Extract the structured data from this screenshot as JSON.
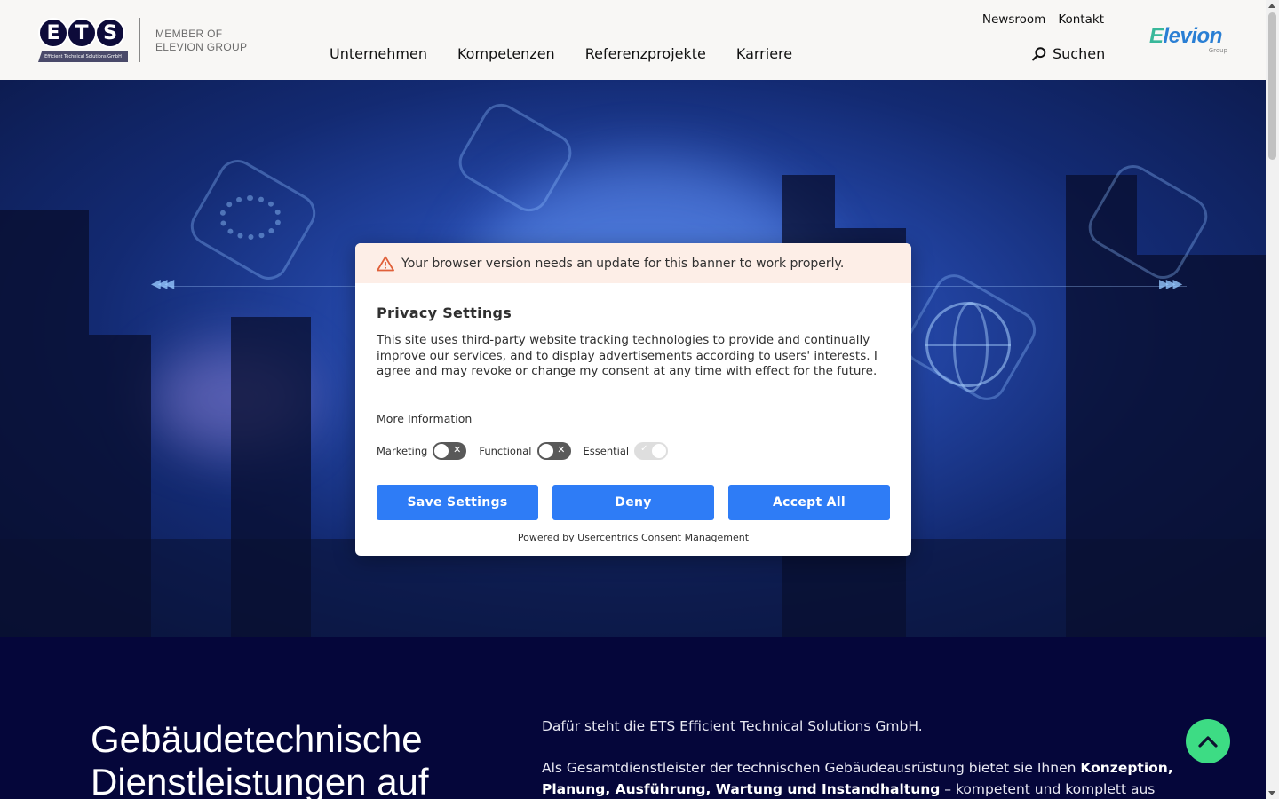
{
  "header": {
    "logo_letters": [
      "E",
      "T",
      "S"
    ],
    "logo_sub": "Efficient Technical Solutions GmbH",
    "member_line1": "MEMBER OF",
    "member_line2": "ELEVION GROUP",
    "main_nav": [
      "Unternehmen",
      "Kompetenzen",
      "Referenzprojekte",
      "Karriere"
    ],
    "top_nav": [
      "Newsroom",
      "Kontakt"
    ],
    "search_label": "Suchen",
    "partner_logo_word": "levion",
    "partner_logo_first": "E",
    "partner_logo_sub": "Group"
  },
  "consent": {
    "warning": "Your browser version needs an update for this banner to work properly.",
    "title": "Privacy Settings",
    "description": "This site uses third-party website tracking technologies to provide and continually improve our services, and to display advertisements according to users' interests. I agree and may revoke or change my consent at any time with effect for the future.",
    "more_info": "More Information",
    "toggles": [
      {
        "label": "Marketing",
        "on": false
      },
      {
        "label": "Functional",
        "on": false
      },
      {
        "label": "Essential",
        "on": true
      }
    ],
    "buttons": {
      "save": "Save Settings",
      "deny": "Deny",
      "accept": "Accept All"
    },
    "powered_by": "Powered by Usercentrics Consent Management"
  },
  "section": {
    "heading": "Gebäudetechnische Dienstleistungen auf",
    "intro": "Dafür steht die ETS Efficient Technical Solutions GmbH.",
    "text_pre": "Als Gesamtdienstleister der technischen Gebäudeausrüstung bietet sie Ihnen ",
    "text_bold": "Konzeption, Planung, Ausführung, Wartung und Instandhaltung",
    "text_post": " – kompetent und komplett aus einer"
  },
  "colors": {
    "accent_button": "#2e7cf6",
    "dark_section": "#05063a",
    "to_top": "#3ddc84"
  }
}
